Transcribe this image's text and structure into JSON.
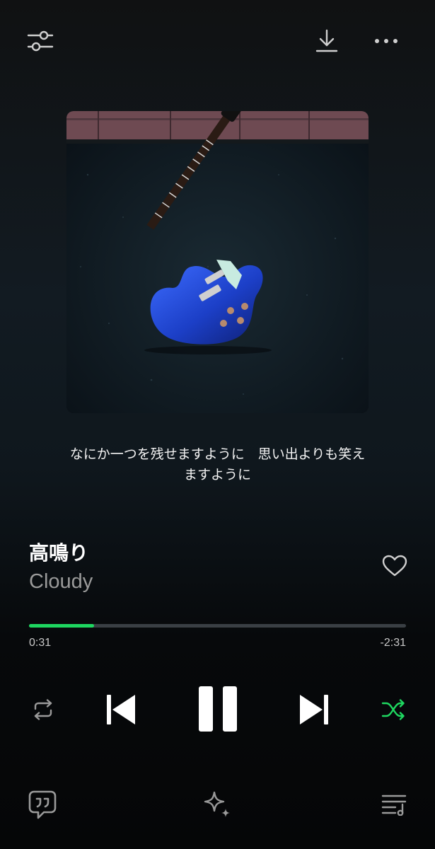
{
  "top_bar": {
    "settings_icon": "sliders-icon",
    "download_icon": "download-icon",
    "more_icon": "more-horizontal-icon"
  },
  "album_art": {
    "description_icon": "album-cover-image"
  },
  "lyrics": {
    "current_line": "なにか一つを残せますように　思い出よりも笑え\nますように"
  },
  "track": {
    "title": "高鳴り",
    "artist": "Cloudy",
    "liked": false
  },
  "progress": {
    "elapsed": "0:31",
    "remaining": "-2:31",
    "fraction": 0.173
  },
  "controls": {
    "repeat_icon": "repeat-icon",
    "previous_icon": "skip-previous-icon",
    "pause_icon": "pause-icon",
    "next_icon": "skip-next-icon",
    "shuffle_icon": "shuffle-icon",
    "shuffle_active": true
  },
  "bottom_bar": {
    "lyrics_icon": "lyrics-quote-icon",
    "ai_icon": "sparkle-icon",
    "queue_icon": "queue-icon"
  },
  "colors": {
    "accent": "#1ed760",
    "text_primary": "#ffffff",
    "text_secondary": "#9a9a9a",
    "background": "#0f171d"
  }
}
